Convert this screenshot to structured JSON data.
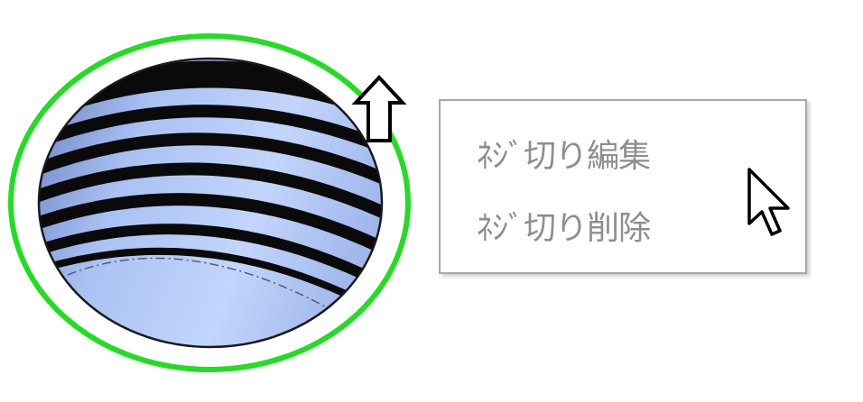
{
  "viewport": {
    "highlight_color": "#22dd22",
    "thread_dark": "#0a0a0a",
    "thread_light": "#a9c2f2",
    "bore_light": "#b7cdf8",
    "bore_dark": "#6f86c8"
  },
  "context_menu": {
    "items": [
      {
        "label": "ﾈｼﾞ切り編集"
      },
      {
        "label": "ﾈｼﾞ切り削除"
      }
    ],
    "text_color": "#8e8e8e",
    "border_color": "#a8a8a8"
  },
  "icons": {
    "direction_arrow": "up-arrow-icon",
    "pointer": "mouse-cursor-icon"
  }
}
